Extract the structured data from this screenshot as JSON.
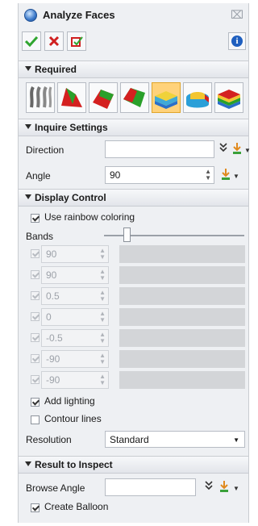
{
  "window": {
    "title": "Analyze Faces",
    "close_glyph": "⌧"
  },
  "toolbar": {
    "ok_icon": "check-icon",
    "cancel_icon": "cross-icon",
    "apply_icon": "apply-icon",
    "info_icon": "info-icon",
    "info_glyph": "i"
  },
  "sections": {
    "required": "Required",
    "inquire": "Inquire Settings",
    "display": "Display Control",
    "result": "Result to Inspect"
  },
  "required": {
    "face_types": [
      "draft-faces",
      "undercut-faces",
      "side-faces",
      "top-bottom-faces",
      "curvature-faces",
      "blend-faces",
      "rainbow-faces"
    ],
    "active_index": 4
  },
  "inquire": {
    "direction_label": "Direction",
    "direction_value": "",
    "angle_label": "Angle",
    "angle_value": "90"
  },
  "display": {
    "rainbow_label": "Use rainbow coloring",
    "rainbow_checked": true,
    "bands_label": "Bands",
    "bands_slider_level": 0.15,
    "bands": [
      "90",
      "90",
      "0.5",
      "0",
      "-0.5",
      "-90",
      "-90"
    ],
    "lighting_label": "Add lighting",
    "lighting_checked": true,
    "contour_label": "Contour lines",
    "contour_checked": false,
    "resolution_label": "Resolution",
    "resolution_value": "Standard"
  },
  "result": {
    "browse_label": "Browse Angle",
    "browse_value": "",
    "balloon_label": "Create Balloon",
    "balloon_checked": true
  },
  "colors": {
    "accept": "#2fa52f",
    "cancel": "#d02020",
    "info": "#1f5fbf",
    "panel": "#eef0f3"
  }
}
